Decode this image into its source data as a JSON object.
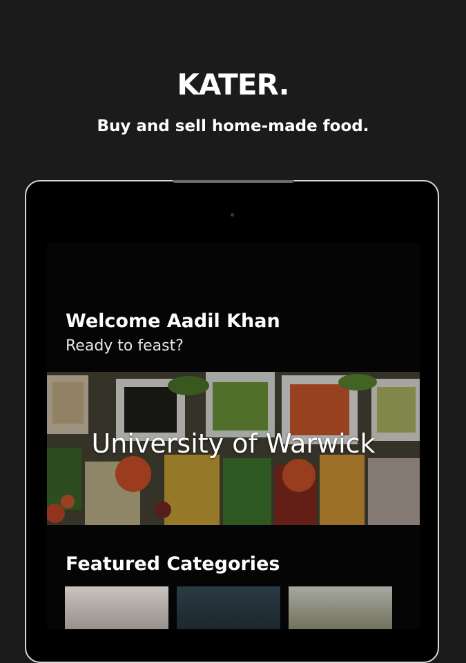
{
  "promo": {
    "brand": "KATER.",
    "tagline": "Buy and sell home-made food."
  },
  "app": {
    "welcome_title": "Welcome Aadil Khan",
    "welcome_sub": "Ready to feast?",
    "campus": {
      "name": "University of Warwick",
      "image_icon": "food-bowls-photo"
    },
    "featured": {
      "title": "Featured Categories",
      "categories": [
        {
          "icon": "category-image"
        },
        {
          "icon": "category-image"
        },
        {
          "icon": "category-image"
        }
      ]
    }
  },
  "colors": {
    "background": "#1b1b1b",
    "device_frame": "#d9d9d9",
    "screen": "#050505",
    "text": "#ffffff"
  }
}
